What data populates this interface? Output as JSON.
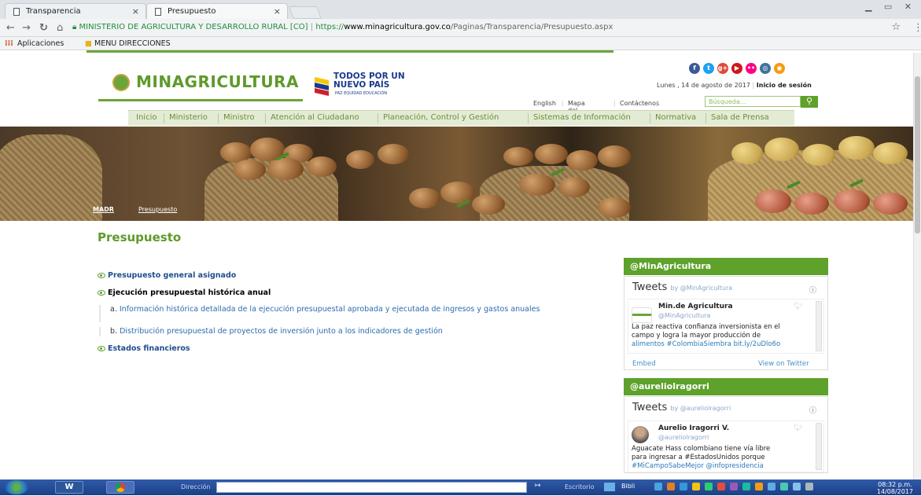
{
  "browser": {
    "tabs": [
      {
        "title": "Transparencia"
      },
      {
        "title": "Presupuesto"
      }
    ],
    "tab_close": "×",
    "address": {
      "org": "MINISTERIO DE AGRICULTURA Y DESARROLLO RURAL [CO]",
      "scheme": "https://",
      "host": "www.minagricultura.gov.co",
      "path": "/Paginas/Transparencia/Presupuesto.aspx"
    },
    "bookmarks": [
      "Aplicaciones",
      "MENU DIRECCIONES"
    ]
  },
  "site": {
    "logo_text": "MINAGRICULTURA",
    "partner_logo": {
      "line1": "TODOS POR UN",
      "line2": "NUEVO PAÍS",
      "tagline": "PAZ  EQUIDAD  EDUCACIÓN"
    },
    "social": [
      {
        "icon": "facebook-icon",
        "glyph": "f",
        "color": "#3b5998"
      },
      {
        "icon": "twitter-icon",
        "glyph": "t",
        "color": "#1da1f2"
      },
      {
        "icon": "googleplus-icon",
        "glyph": "g+",
        "color": "#dd4b39"
      },
      {
        "icon": "youtube-icon",
        "glyph": "▶",
        "color": "#cc181e"
      },
      {
        "icon": "flickr-icon",
        "glyph": "••",
        "color": "#ff0084"
      },
      {
        "icon": "instagram-icon",
        "glyph": "◎",
        "color": "#3f729b"
      },
      {
        "icon": "rss-icon",
        "glyph": "◉",
        "color": "#f39c12"
      }
    ],
    "date": "Lunes , 14 de agosto de 2017",
    "login": "Inicio de sesión",
    "utility_links": [
      "English",
      "Mapa del sitio",
      "Contáctenos"
    ],
    "search_placeholder": "Búsqueda...",
    "nav": [
      "Inicio",
      "Ministerio",
      "Ministro",
      "Atención al Ciudadano",
      "Planeación, Control y Gestión",
      "Sistemas de Información",
      "Normativa",
      "Sala de Prensa"
    ],
    "breadcrumb": [
      "MADR",
      "Presupuesto"
    ]
  },
  "content": {
    "title": "Presupuesto",
    "items": [
      {
        "label": "Presupuesto general asignado"
      },
      {
        "label": "Ejecución presupuestal histórica anual"
      },
      {
        "label": "Estados financieros"
      }
    ],
    "subitems": [
      {
        "prefix": "a.",
        "text": "Información histórica detallada de la ejecución presupuestal aprobada y ejecutada de ingresos y gastos anuales"
      },
      {
        "prefix": "b.",
        "text": "Distribución presupuestal de proyectos de inversión junto a los indicadores de gestión"
      }
    ]
  },
  "widgets": [
    {
      "header": "@MinAgricultura",
      "tweets_label": "Tweets",
      "by": "by @MinAgricultura",
      "author": "Min.de Agricultura",
      "handle": "@MinAgricultura",
      "body_lines": [
        "La paz reactiva confianza inversionista en el",
        "campo y logra la mayor producción de",
        "alimentos #ColombiaSiembra bit.ly/2uDlo6o"
      ],
      "embed": "Embed",
      "view": "View on Twitter"
    },
    {
      "header": "@aureliolragorri",
      "tweets_label": "Tweets",
      "by": "by @aureliolragorri",
      "author": "Aurelio Iragorri V.",
      "handle": "@aureliolragorri",
      "body_lines": [
        "Aguacate Hass colombiano tiene vía libre",
        "para ingresar a #EstadosUnidos porque",
        "#MiCampoSabeMejor @infopresidencia"
      ]
    }
  ],
  "taskbar": {
    "direccion": "Dirección",
    "escritorio": "Escritorio",
    "bibli": "Bibli",
    "time": "08:32 p.m.",
    "date": "14/08/2017"
  }
}
